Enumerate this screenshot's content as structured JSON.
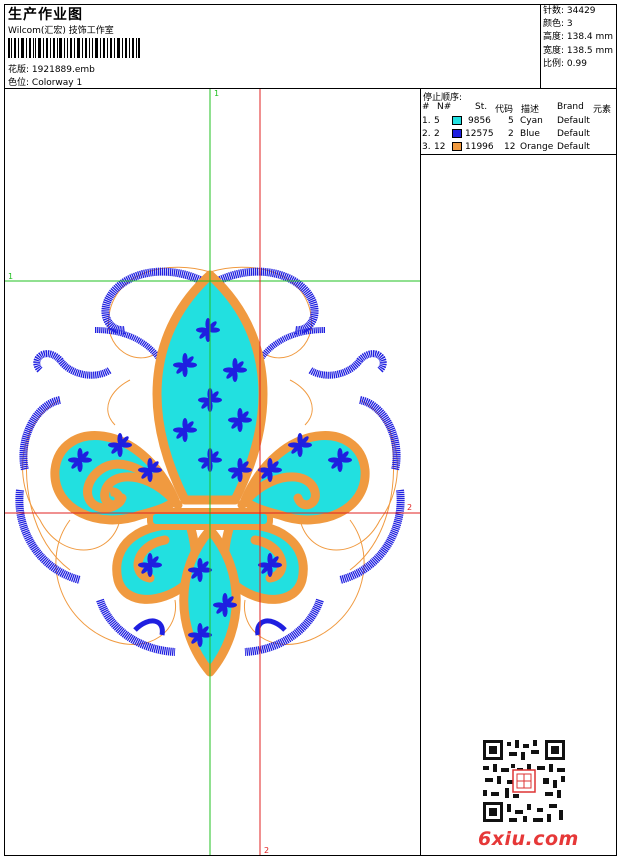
{
  "header": {
    "title": "生产作业图",
    "subtitle": "Wilcom(汇宏) 技饰工作室",
    "design_label": "花版:",
    "design_value": "1921889.emb",
    "colorway_label": "色位:",
    "colorway_value": "Colorway 1"
  },
  "stats": {
    "stitches": "针数: 34429",
    "colors": "颜色: 3",
    "height": "高度: 138.4 mm",
    "width": "宽度: 138.5 mm",
    "scale": "比例: 0.99"
  },
  "stop_sequence": {
    "title": "停止顺序:",
    "columns": [
      "#",
      "N#",
      "St.",
      "代码",
      "描述",
      "Brand",
      "元素"
    ],
    "rows": [
      {
        "idx": "1.",
        "n": "5",
        "stitches": "9856",
        "code": "5",
        "desc": "Cyan",
        "brand": "Default",
        "color": "#22e0e0"
      },
      {
        "idx": "2.",
        "n": "2",
        "stitches": "12575",
        "code": "2",
        "desc": "Blue",
        "brand": "Default",
        "color": "#1f1fe0"
      },
      {
        "idx": "3.",
        "n": "12",
        "stitches": "11996",
        "code": "12",
        "desc": "Orange",
        "brand": "Default",
        "color": "#f09a40"
      }
    ]
  },
  "axes": {
    "v_green": "1",
    "h_green": "1",
    "h_red": "2",
    "v_red": "2"
  },
  "watermark": "6xiu.com",
  "palette": {
    "cyan": "#22e0e0",
    "blue": "#1f1fe0",
    "orange": "#f09a40",
    "green": "#22c022",
    "red": "#e02020"
  }
}
